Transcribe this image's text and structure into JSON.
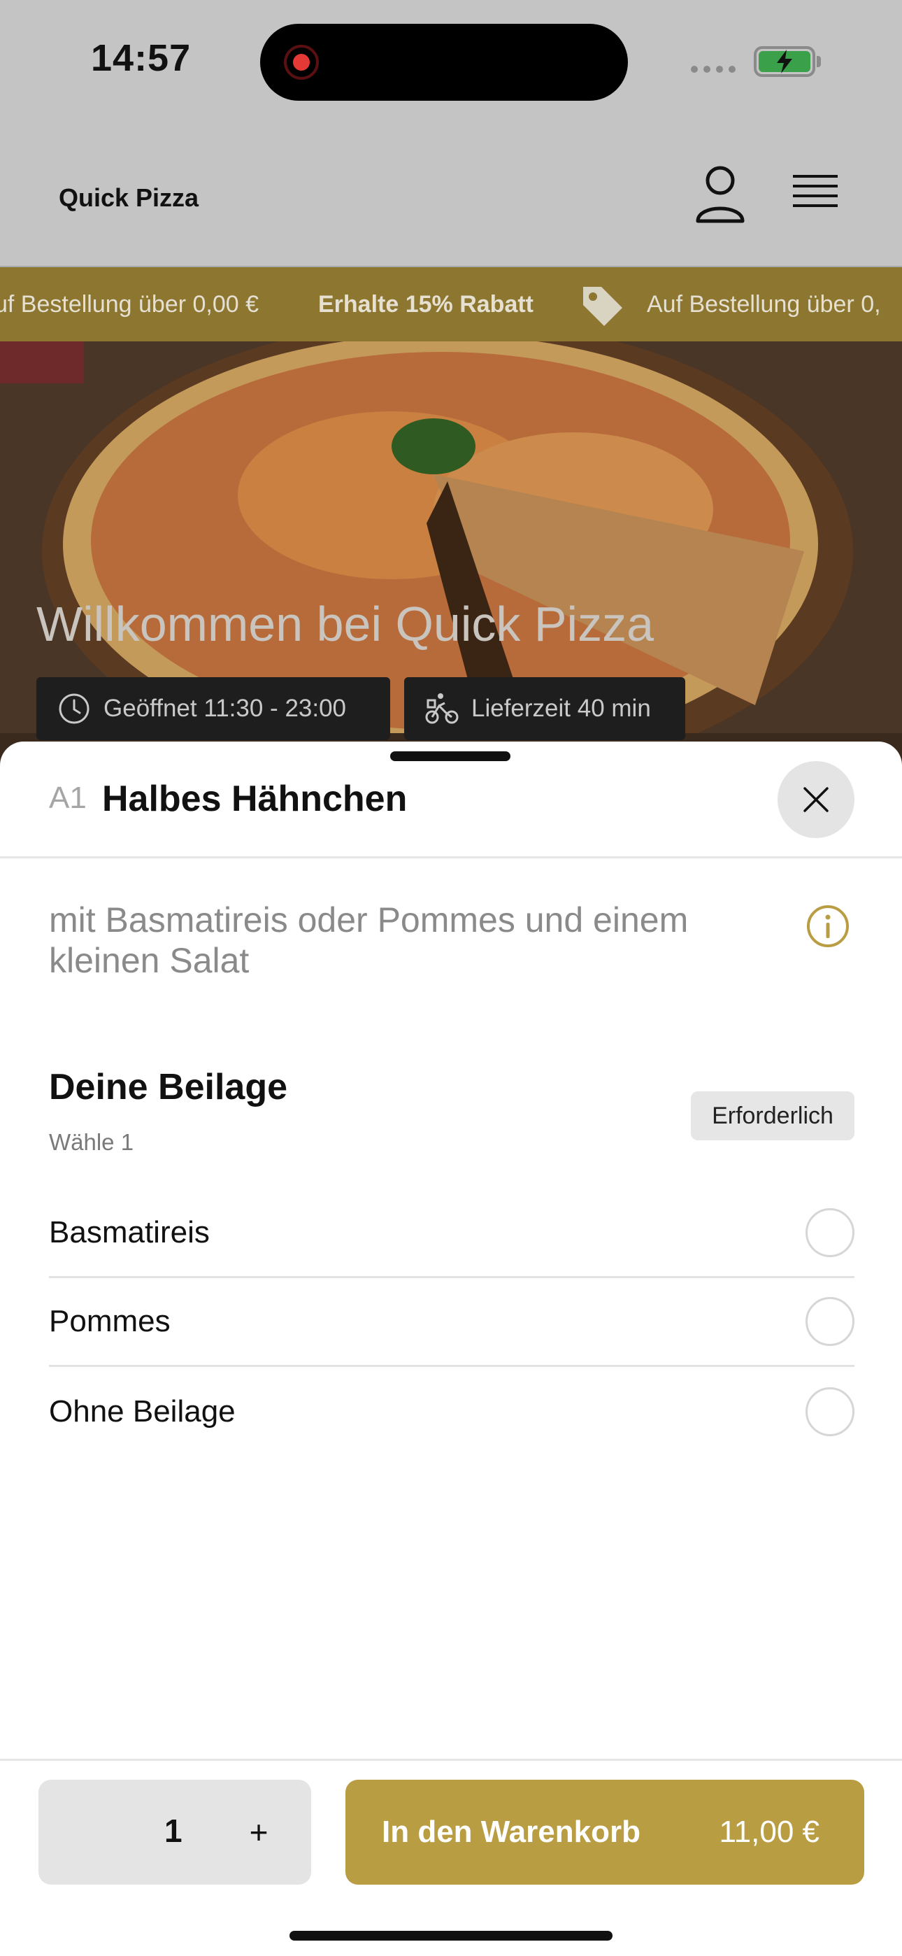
{
  "status_bar": {
    "time": "14:57"
  },
  "header": {
    "brand": "Quick Pizza"
  },
  "promo_ticker": {
    "left_text": "uf Bestellung über 0,00 €",
    "highlight_text": "Erhalte 15% Rabatt",
    "right_text": "Auf Bestellung über 0,"
  },
  "hero": {
    "title": "Willkommen bei Quick Pizza",
    "opening_hours": "Geöffnet 11:30 - 23:00",
    "delivery_time": "Lieferzeit 40 min"
  },
  "item_sheet": {
    "code": "A1",
    "title": "Halbes Hähnchen",
    "description": "mit Basmatireis oder Pommes und einem kleinen Salat",
    "section": {
      "title": "Deine Beilage",
      "subtitle": "Wähle 1",
      "badge": "Erforderlich",
      "options": [
        {
          "label": "Basmatireis",
          "selected": false
        },
        {
          "label": "Pommes",
          "selected": false
        },
        {
          "label": "Ohne Beilage",
          "selected": false
        }
      ]
    },
    "quantity": "1",
    "plus_label": "+",
    "add_to_cart_label": "In den Warenkorb",
    "price": "11,00 €"
  },
  "colors": {
    "accent": "#B99D43",
    "overlay": "#C4C4C4",
    "ticker_bg": "#8C7630"
  }
}
